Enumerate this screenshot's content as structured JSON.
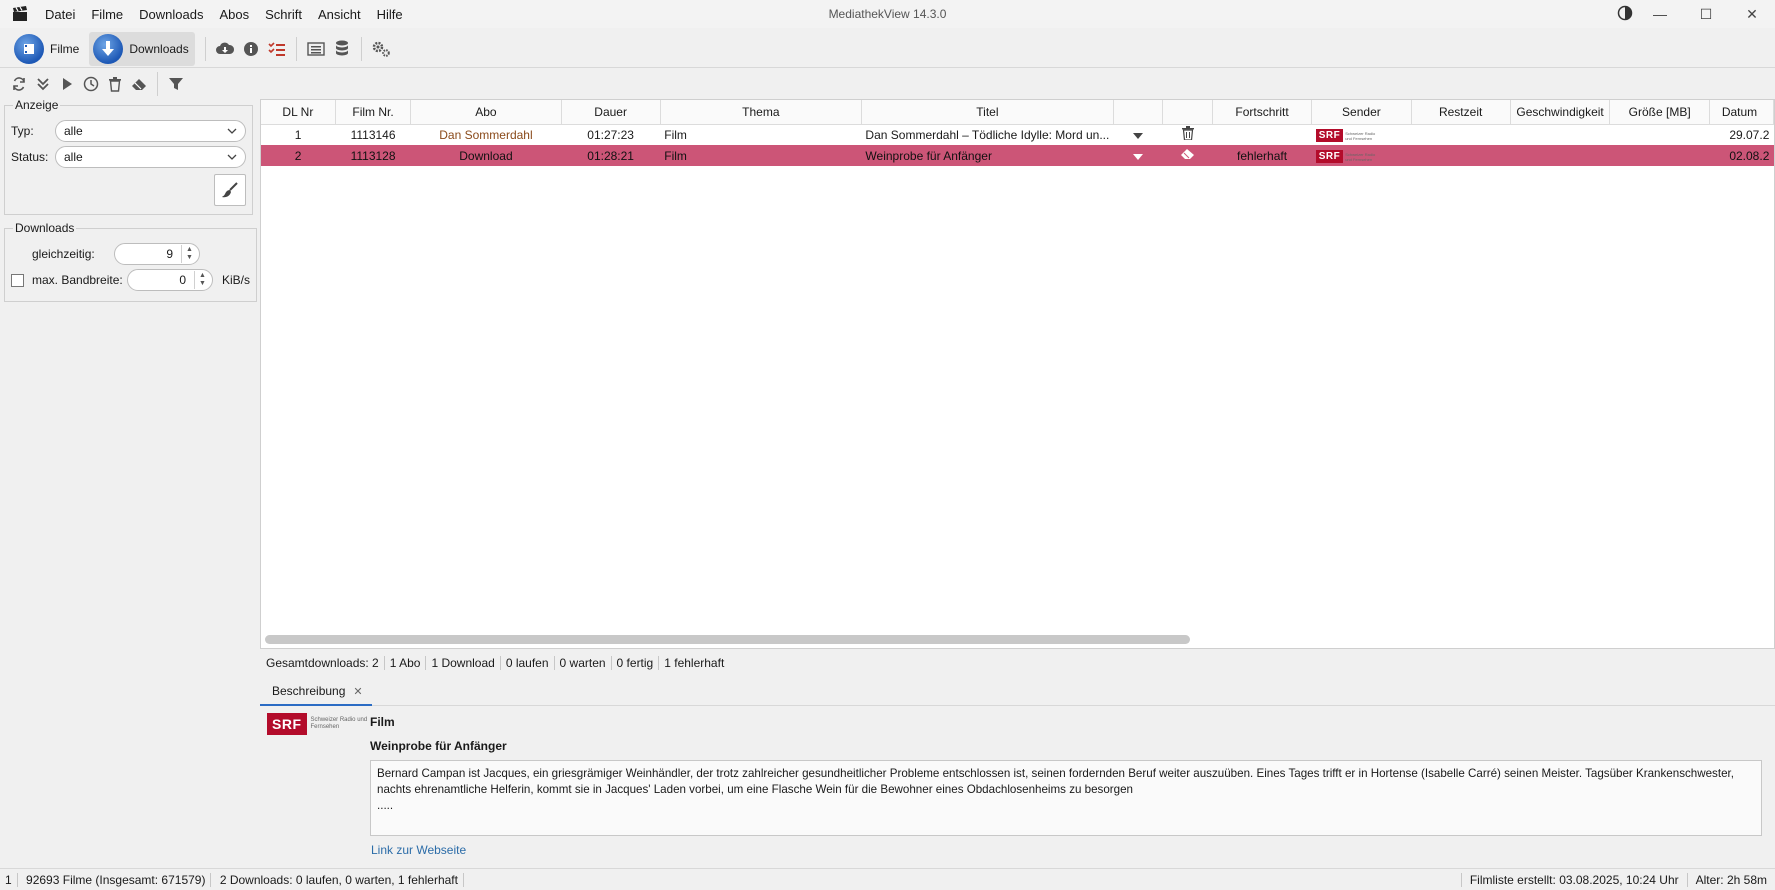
{
  "window": {
    "title": "MediathekView 14.3.0"
  },
  "menu": [
    "Datei",
    "Filme",
    "Downloads",
    "Abos",
    "Schrift",
    "Ansicht",
    "Hilfe"
  ],
  "toolbar": {
    "filme_label": "Filme",
    "downloads_label": "Downloads"
  },
  "filter": {
    "legend": "Anzeige",
    "typ_label": "Typ:",
    "typ_value": "alle",
    "status_label": "Status:",
    "status_value": "alle"
  },
  "downloads_panel": {
    "legend": "Downloads",
    "concurrent_label": "gleichzeitig:",
    "concurrent_value": "9",
    "bandwidth_label": "max. Bandbreite:",
    "bandwidth_value": "0",
    "bandwidth_unit": "KiB/s"
  },
  "table": {
    "columns": [
      "DL Nr",
      "Film Nr.",
      "Abo",
      "Dauer",
      "Thema",
      "Titel",
      "",
      "",
      "Fortschritt",
      "Sender",
      "Restzeit",
      "Geschwindigkeit",
      "Größe [MB]",
      "Datum"
    ],
    "rows": [
      {
        "dl_nr": "1",
        "film_nr": "1113146",
        "abo": "Dan Sommerdahl",
        "dauer": "01:27:23",
        "thema": "Film",
        "titel": "Dan Sommerdahl – Tödliche Idylle: Mord un...",
        "fortschritt": "",
        "sender": "SRF",
        "restzeit": "",
        "geschwindigkeit": "",
        "groesse": "",
        "datum": "29.07.2",
        "selected": false
      },
      {
        "dl_nr": "2",
        "film_nr": "1113128",
        "abo": "Download",
        "dauer": "01:28:21",
        "thema": "Film",
        "titel": "Weinprobe für Anfänger",
        "fortschritt": "fehlerhaft",
        "sender": "SRF",
        "restzeit": "",
        "geschwindigkeit": "",
        "groesse": "",
        "datum": "02.08.2",
        "selected": true
      }
    ],
    "selected_row_color": "#cc5577"
  },
  "summary": [
    "Gesamtdownloads: 2",
    "1 Abo",
    "1 Download",
    "0 laufen",
    "0 warten",
    "0 fertig",
    "1 fehlerhaft"
  ],
  "description": {
    "tab_label": "Beschreibung",
    "thema": "Film",
    "title": "Weinprobe für Anfänger",
    "text_line1": "Bernard Campan ist Jacques, ein griesgrämiger Weinhändler, der trotz zahlreicher gesundheitlicher Probleme entschlossen ist, seinen fordernden Beruf weiter auszuüben. Eines Tages trifft er in Hortense (Isabelle Carré) seinen Meister. Tagsüber Krankenschwester,",
    "text_line2": "nachts ehrenamtliche Helferin, kommt sie in Jacques' Laden vorbei, um eine Flasche Wein für die Bewohner eines Obdachlosenheims zu besorgen",
    "text_line3": ".....",
    "link": "Link zur Webseite",
    "sender_logo": "SRF",
    "sender_logo_sub": "Schweizer Radio und Fernsehen"
  },
  "statusbar": {
    "left": [
      "1",
      "92693 Filme (Insgesamt: 671579)",
      "2 Downloads: 0 laufen, 0 warten, 1 fehlerhaft"
    ],
    "filmliste": "Filmliste erstellt: 03.08.2025, 10:24 Uhr",
    "alter": "Alter: 2h 58m"
  }
}
